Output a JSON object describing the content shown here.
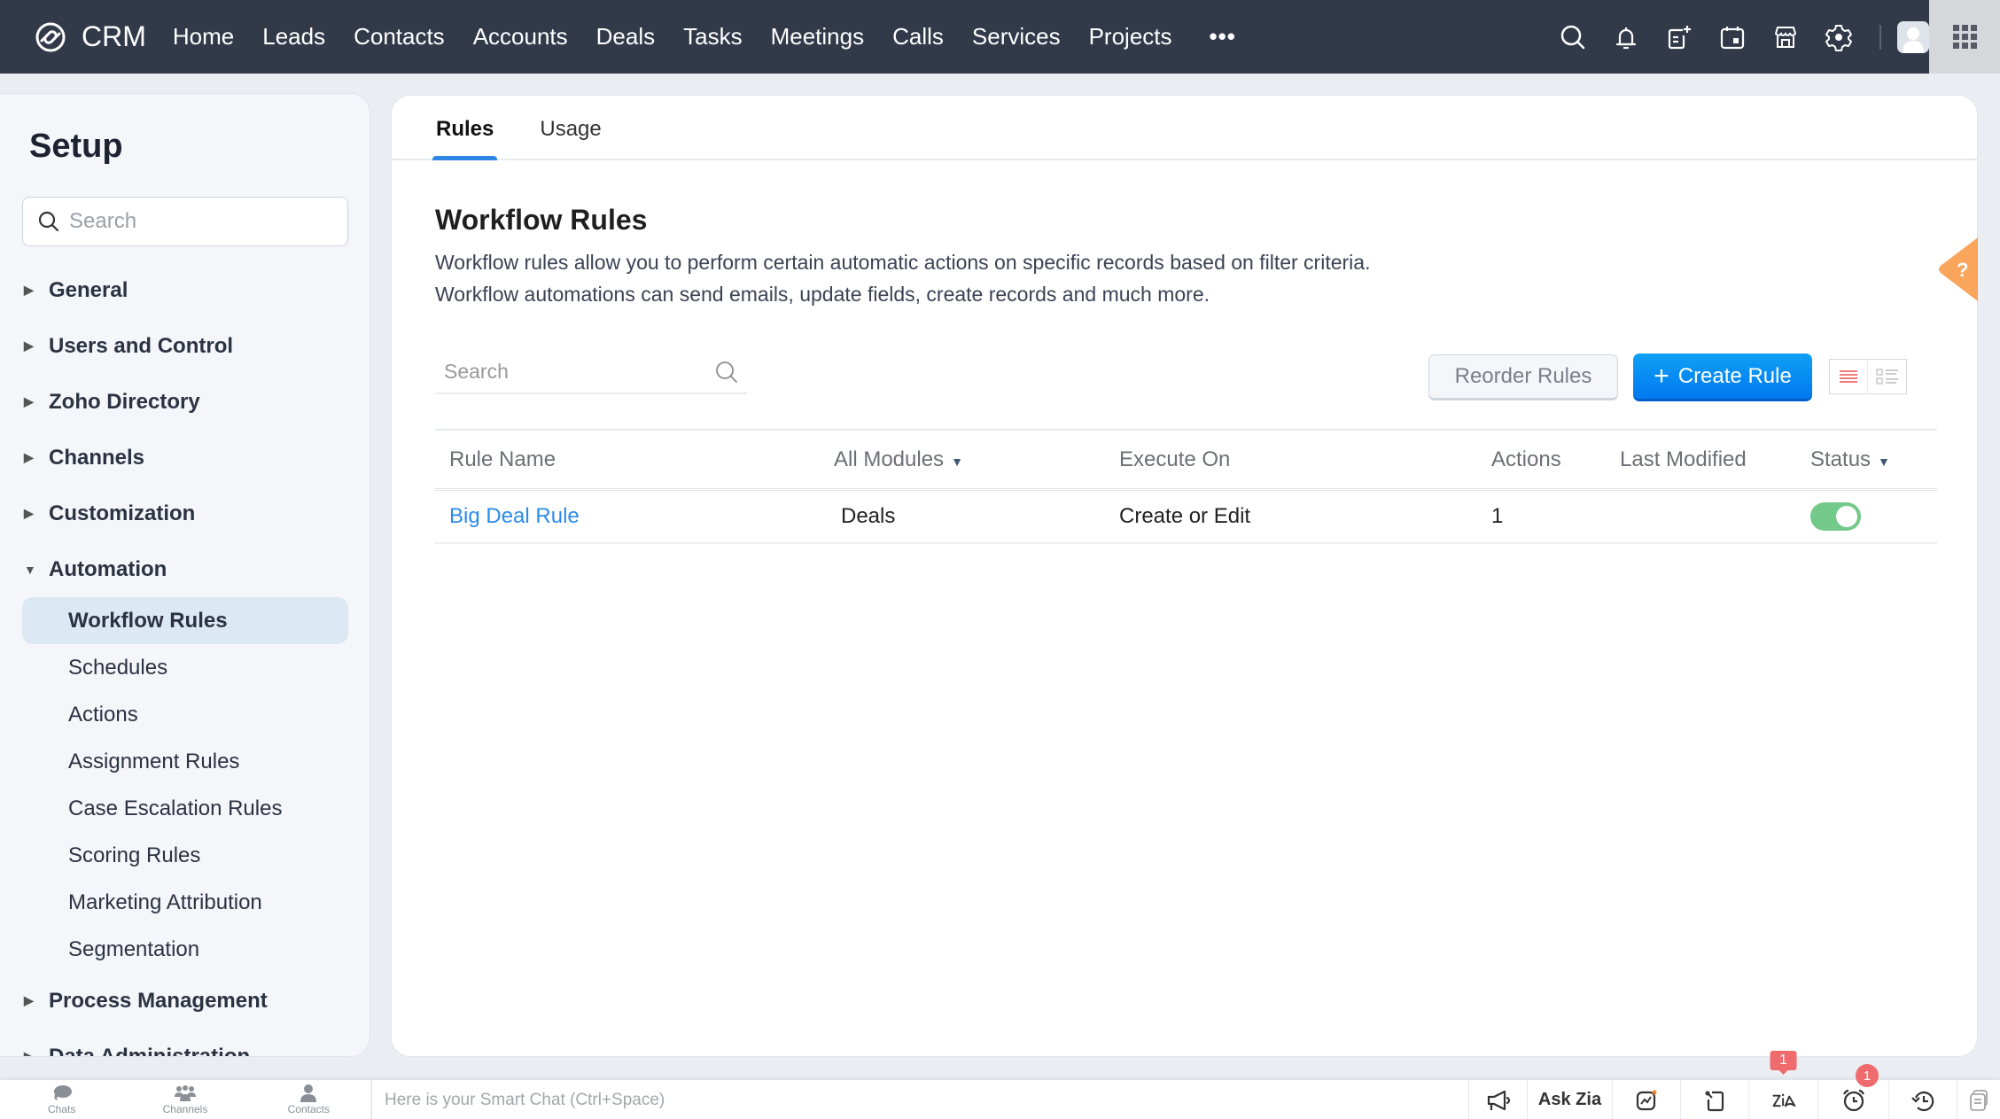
{
  "topbar": {
    "app_name": "CRM",
    "nav": [
      "Home",
      "Leads",
      "Contacts",
      "Accounts",
      "Deals",
      "Tasks",
      "Meetings",
      "Calls",
      "Services",
      "Projects"
    ],
    "more_label": "•••",
    "icons": [
      "search-icon",
      "bell-icon",
      "new-note-icon",
      "calendar-icon",
      "marketplace-icon",
      "gear-icon",
      "avatar",
      "apps-grid-icon"
    ]
  },
  "sidebar": {
    "title": "Setup",
    "search_placeholder": "Search",
    "sections": [
      {
        "label": "General",
        "expanded": false
      },
      {
        "label": "Users and Control",
        "expanded": false
      },
      {
        "label": "Zoho Directory",
        "expanded": false
      },
      {
        "label": "Channels",
        "expanded": false
      },
      {
        "label": "Customization",
        "expanded": false
      },
      {
        "label": "Automation",
        "expanded": true,
        "items": [
          {
            "label": "Workflow Rules",
            "active": true
          },
          {
            "label": "Schedules"
          },
          {
            "label": "Actions"
          },
          {
            "label": "Assignment Rules"
          },
          {
            "label": "Case Escalation Rules"
          },
          {
            "label": "Scoring Rules"
          },
          {
            "label": "Marketing Attribution"
          },
          {
            "label": "Segmentation"
          }
        ]
      },
      {
        "label": "Process Management",
        "expanded": false
      },
      {
        "label": "Data Administration",
        "expanded": false
      }
    ]
  },
  "main": {
    "tabs": [
      {
        "label": "Rules",
        "active": true
      },
      {
        "label": "Usage",
        "active": false
      }
    ],
    "title": "Workflow Rules",
    "description_line1": "Workflow rules allow you to perform certain automatic actions on specific records based on filter criteria.",
    "description_line2": "Workflow automations can send emails, update fields, create records and much more.",
    "search_placeholder": "Search",
    "reorder_label": "Reorder Rules",
    "create_label": "Create Rule",
    "create_icon": "+",
    "table": {
      "columns": [
        "Rule Name",
        "All Modules",
        "Execute On",
        "Actions",
        "Last Modified",
        "Status"
      ],
      "rows": [
        {
          "rule_name": "Big Deal Rule",
          "module": "Deals",
          "execute_on": "Create or Edit",
          "actions": "1",
          "last_modified": "",
          "status_enabled": true
        }
      ]
    },
    "help_label": "?"
  },
  "colors": {
    "topbar_bg": "#323949",
    "primary_blue": "#0a8cf2",
    "link_blue": "#2b8bea",
    "toggle_on": "#72c98a",
    "help_orange": "#f9a55b",
    "badge_red": "#ef6b6e"
  },
  "bottombar": {
    "left_items": [
      "Chats",
      "Channels",
      "Contacts"
    ],
    "smartchat_placeholder": "Here is your Smart Chat (Ctrl+Space)",
    "ask_zia": "Ask Zia",
    "zia_badge": "1",
    "alarm_badge": "1"
  }
}
